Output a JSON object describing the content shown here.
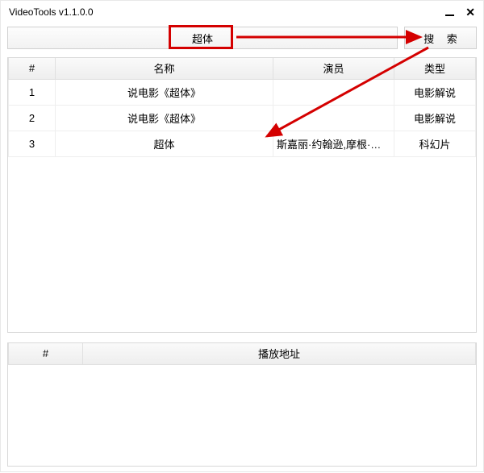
{
  "window": {
    "title": "VideoTools v1.1.0.0"
  },
  "search": {
    "value": "超体",
    "button": "搜 索"
  },
  "results": {
    "headers": {
      "index": "#",
      "name": "名称",
      "actors": "演员",
      "type": "类型"
    },
    "rows": [
      {
        "index": "1",
        "name": "说电影《超体》",
        "actors": "",
        "type": "电影解说"
      },
      {
        "index": "2",
        "name": "说电影《超体》",
        "actors": "",
        "type": "电影解说"
      },
      {
        "index": "3",
        "name": "超体",
        "actors": "斯嘉丽·约翰逊,摩根·弗里...",
        "type": "科幻片"
      }
    ]
  },
  "playlist": {
    "headers": {
      "index": "#",
      "url": "播放地址"
    }
  }
}
